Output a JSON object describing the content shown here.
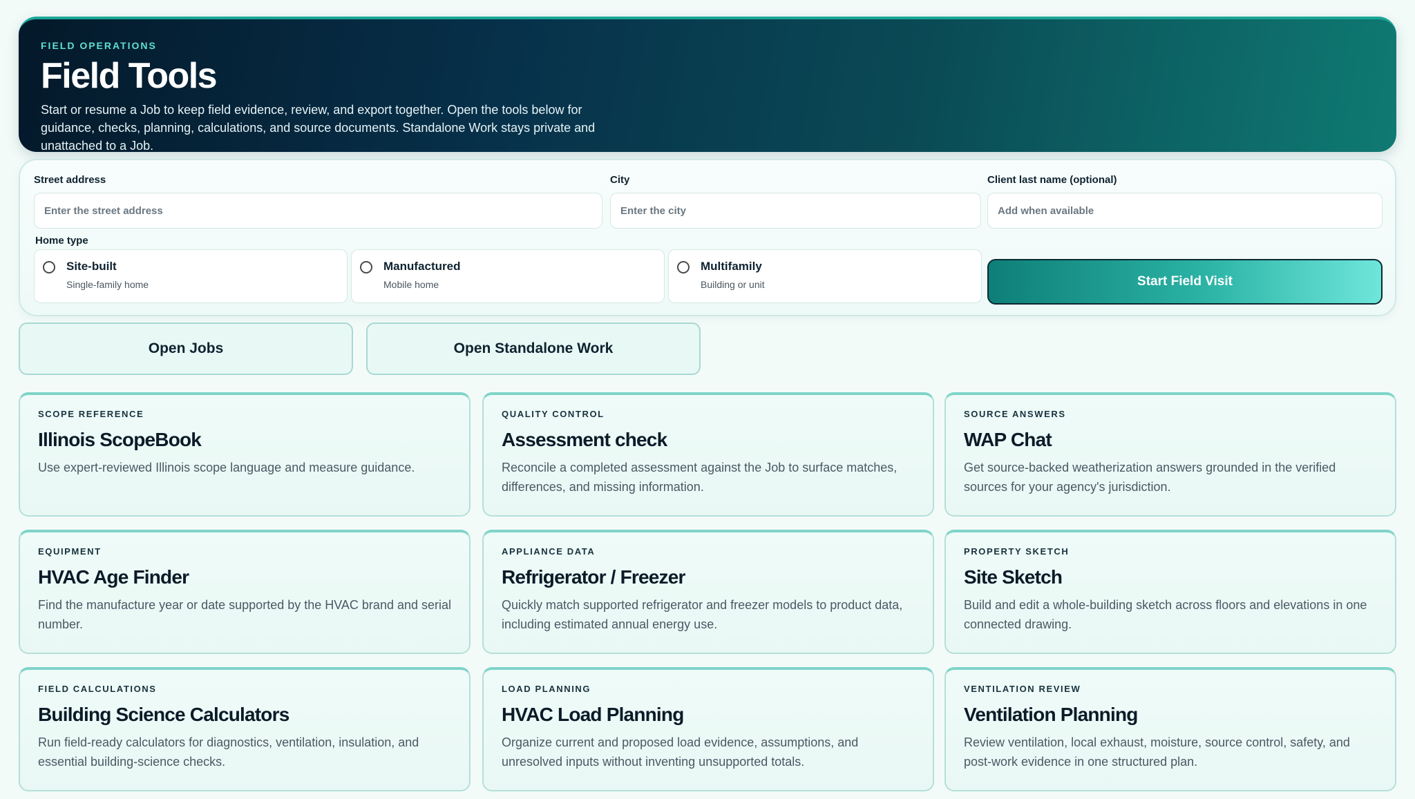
{
  "hero": {
    "eyebrow": "FIELD OPERATIONS",
    "title": "Field Tools",
    "description": "Start or resume a Job to keep field evidence, review, and export together. Open the tools below for guidance, checks, planning, calculations, and source documents. Standalone Work stays private and unattached to a Job."
  },
  "form": {
    "street": {
      "label": "Street address",
      "placeholder": "Enter the street address",
      "value": ""
    },
    "city": {
      "label": "City",
      "placeholder": "Enter the city",
      "value": ""
    },
    "client": {
      "label": "Client last name (optional)",
      "placeholder": "Add when available",
      "value": ""
    },
    "home_type_label": "Home type",
    "home_types": [
      {
        "title": "Site-built",
        "subtitle": "Single-family home",
        "selected": false
      },
      {
        "title": "Manufactured",
        "subtitle": "Mobile home",
        "selected": false
      },
      {
        "title": "Multifamily",
        "subtitle": "Building or unit",
        "selected": false
      }
    ],
    "start_button": "Start Field Visit"
  },
  "open_buttons": {
    "jobs": "Open Jobs",
    "standalone": "Open Standalone Work"
  },
  "tools": [
    {
      "eyebrow": "SCOPE REFERENCE",
      "title": "Illinois ScopeBook",
      "description": "Use expert-reviewed Illinois scope language and measure guidance."
    },
    {
      "eyebrow": "QUALITY CONTROL",
      "title": "Assessment check",
      "description": "Reconcile a completed assessment against the Job to surface matches, differences, and missing information."
    },
    {
      "eyebrow": "SOURCE ANSWERS",
      "title": "WAP Chat",
      "description": "Get source-backed weatherization answers grounded in the verified sources for your agency's jurisdiction."
    },
    {
      "eyebrow": "EQUIPMENT",
      "title": "HVAC Age Finder",
      "description": "Find the manufacture year or date supported by the HVAC brand and serial number."
    },
    {
      "eyebrow": "APPLIANCE DATA",
      "title": "Refrigerator / Freezer",
      "description": "Quickly match supported refrigerator and freezer models to product data, including estimated annual energy use."
    },
    {
      "eyebrow": "PROPERTY SKETCH",
      "title": "Site Sketch",
      "description": "Build and edit a whole-building sketch across floors and elevations in one connected drawing."
    },
    {
      "eyebrow": "FIELD CALCULATIONS",
      "title": "Building Science Calculators",
      "description": "Run field-ready calculators for diagnostics, ventilation, insulation, and essential building-science checks."
    },
    {
      "eyebrow": "LOAD PLANNING",
      "title": "HVAC Load Planning",
      "description": "Organize current and proposed load evidence, assumptions, and unresolved inputs without inventing unsupported totals."
    },
    {
      "eyebrow": "VENTILATION REVIEW",
      "title": "Ventilation Planning",
      "description": "Review ventilation, local exhaust, moisture, source control, safety, and post-work evidence in one structured plan."
    }
  ],
  "colors": {
    "accent": "#1aa596",
    "hero_dark": "#04192a",
    "card_border": "#b5dfd8"
  }
}
